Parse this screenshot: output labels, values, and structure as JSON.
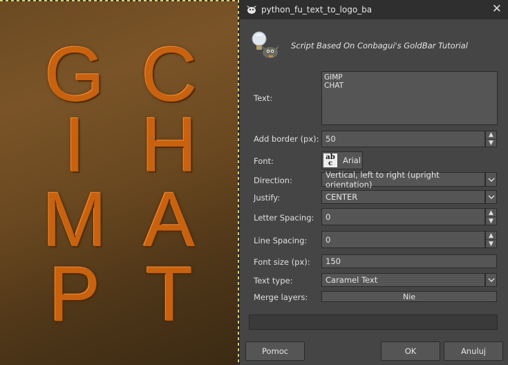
{
  "canvas": {
    "letters": [
      "G",
      "C",
      "I",
      "H",
      "M",
      "A",
      "P",
      "T"
    ],
    "letter_color": "#c8620e"
  },
  "dialog": {
    "title": "python_fu_text_to_logo_ba",
    "close_glyph": "✕",
    "description": "Script Based On Conbagui's GoldBar Tutorial",
    "fields": {
      "text": {
        "label": "Text:",
        "value": "GIMP\nCHAT"
      },
      "add_border": {
        "label": "Add border (px):",
        "value": "50"
      },
      "font": {
        "label": "Font:",
        "value": "Arial",
        "icon_top": "ab",
        "icon_bottom": "c"
      },
      "direction": {
        "label": "Direction:",
        "value": "Vertical, left to right (upright orientation)"
      },
      "justify": {
        "label": "Justify:",
        "value": "CENTER"
      },
      "letter_spacing": {
        "label": "Letter Spacing:",
        "value": "0"
      },
      "line_spacing": {
        "label": "Line Spacing:",
        "value": "0"
      },
      "font_size": {
        "label": "Font size (px):",
        "value": "150"
      },
      "text_type": {
        "label": "Text type:",
        "value": "Caramel Text"
      },
      "merge_layers": {
        "label": "Merge layers:",
        "value": "Nie"
      }
    },
    "buttons": {
      "help": "Pomoc",
      "ok": "OK",
      "cancel": "Anuluj"
    },
    "spin_up": "▲",
    "spin_down": "▼",
    "combo_arrow": "⌄"
  }
}
